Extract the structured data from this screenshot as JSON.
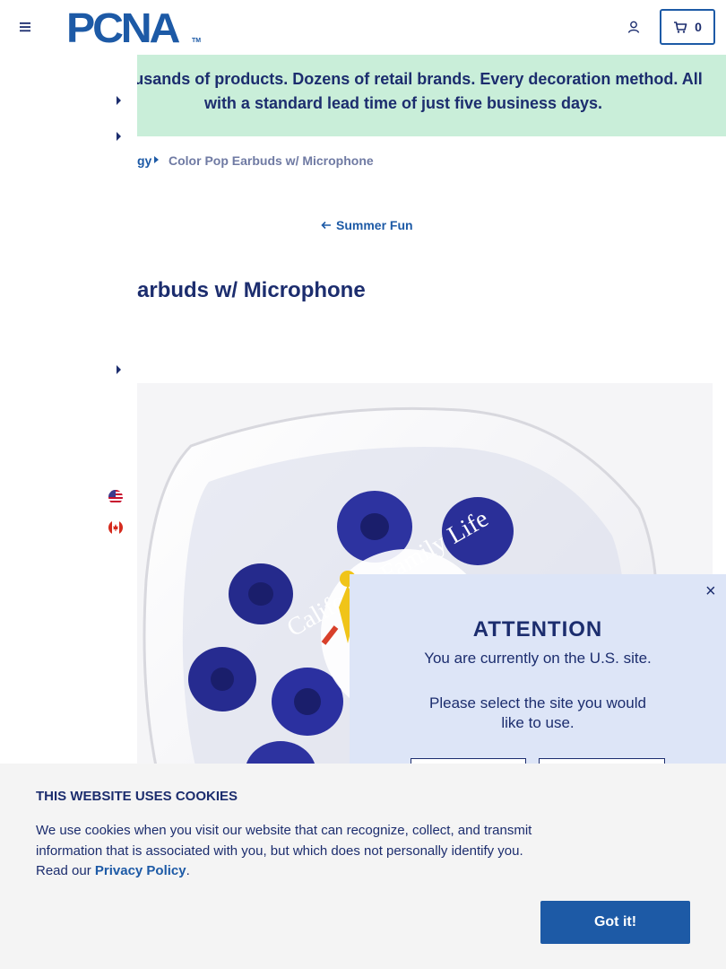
{
  "header": {
    "logo_text": "PCNA",
    "logo_tm": "TM",
    "cart_count": "0"
  },
  "banner": {
    "text": "Thousands of products. Dozens of retail brands. Every decoration method. All with a standard lead time of just five business days."
  },
  "breadcrumb": {
    "previous_label": "gy",
    "current_label": "Color Pop Earbuds w/ Microphone"
  },
  "back_link": {
    "label": "Summer Fun"
  },
  "product": {
    "title": "Color Pop Earbuds w/ Microphone",
    "visible_title": "arbuds w/ Microphone",
    "imprint_text": "California Family Life"
  },
  "modal": {
    "close_label": "×",
    "title": "ATTENTION",
    "line1": "You are currently on the U.S. site.",
    "line2": "Please select the site you would like to use."
  },
  "cookie": {
    "title": "THIS WEBSITE USES COOKIES",
    "body_prefix": "We use cookies when you visit our website that can recognize, collect, and transmit information that is associated with you, but which does not personally identify you. Read our ",
    "link_label": "Privacy Policy",
    "body_suffix": ".",
    "button_label": "Got it!"
  },
  "colors": {
    "brand_blue": "#1d5aa6",
    "navy": "#1c2d6e",
    "banner_green": "#c9eed9",
    "modal_bg": "#dde5f7"
  },
  "icons": [
    "menu-icon",
    "account-icon",
    "cart-icon",
    "chevron-right-icon",
    "arrow-left-icon",
    "us-flag-icon",
    "canada-flag-icon",
    "close-icon"
  ]
}
